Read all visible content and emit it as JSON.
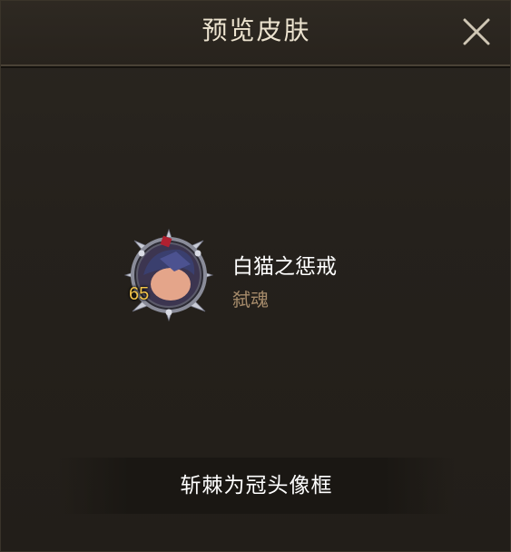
{
  "header": {
    "title": "预览皮肤"
  },
  "skin": {
    "name": "白猫之惩戒",
    "subtitle": "弑魂",
    "level": "65"
  },
  "action": {
    "label": "斩棘为冠头像框"
  },
  "colors": {
    "title": "#ece3cf",
    "subtitle": "#a58a6a",
    "level": "#f0c24a",
    "panel_bg": "#25211c"
  },
  "icons": {
    "close": "close-icon",
    "frame": "spiked-avatar-frame-icon"
  }
}
